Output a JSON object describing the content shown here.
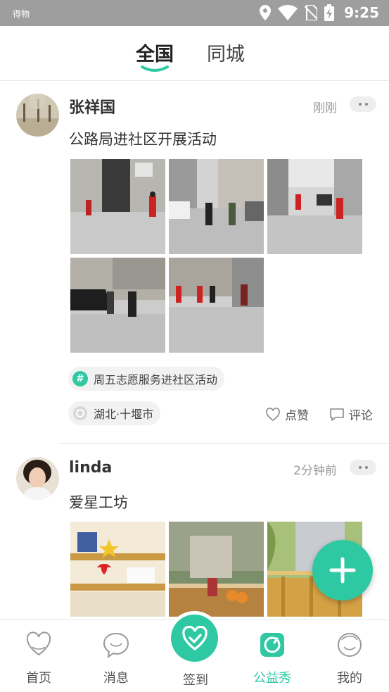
{
  "status_bar": {
    "carrier": "得物",
    "time": "9:25"
  },
  "tabs": [
    {
      "label": "全国",
      "active": true
    },
    {
      "label": "同城",
      "active": false
    }
  ],
  "colors": {
    "accent": "#2ec9a3",
    "status_bar": "#9e9e9e"
  },
  "posts": [
    {
      "username": "张祥国",
      "time": "刚刚",
      "content": "公路局进社区开展活动",
      "photo_count": 5,
      "topic": "周五志愿服务进社区活动",
      "location": "湖北·十堰市",
      "like_label": "点赞",
      "comment_label": "评论"
    },
    {
      "username": "linda",
      "time": "2分钟前",
      "content": "爱星工坊",
      "photo_count": 3
    }
  ],
  "bottom_nav": [
    {
      "label": "首页",
      "icon": "heart-outline-icon",
      "active": false
    },
    {
      "label": "消息",
      "icon": "chat-face-icon",
      "active": false
    },
    {
      "label": "签到",
      "icon": "heart-check-icon",
      "active": false
    },
    {
      "label": "公益秀",
      "icon": "camera-circle-icon",
      "active": true
    },
    {
      "label": "我的",
      "icon": "smiley-face-icon",
      "active": false
    }
  ]
}
